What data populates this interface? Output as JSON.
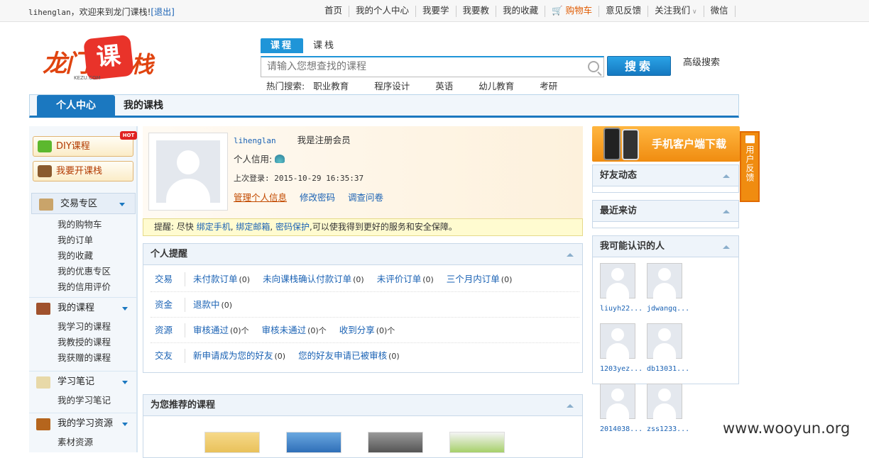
{
  "topbar": {
    "username": "lihenglan",
    "welcome": "，欢迎来到龙门课栈!",
    "logout": "[退出]",
    "nav": [
      "首页",
      "我的个人中心",
      "我要学",
      "我要教",
      "我的收藏",
      "购物车",
      "意见反馈",
      "关注我们",
      "微信"
    ]
  },
  "logo": {
    "part1": "龙门",
    "part2": "课",
    "part3": "栈",
    "domain": "KEZU.COM"
  },
  "search": {
    "tabs": [
      "课程",
      "课栈"
    ],
    "placeholder": "请输入您想查找的课程",
    "button": "搜索",
    "advanced": "高级搜索",
    "hot_label": "热门搜索:",
    "hot": [
      "职业教育",
      "程序设计",
      "英语",
      "幼儿教育",
      "考研"
    ]
  },
  "mainnav": {
    "tabs": [
      "个人中心",
      "我的课栈"
    ]
  },
  "sidebar": {
    "diy": "DIY课程",
    "hot_badge": "HOT",
    "teach": "我要开课栈",
    "groups": [
      {
        "title": "交易专区",
        "items": [
          "我的购物车",
          "我的订单",
          "我的收藏",
          "我的优惠专区",
          "我的信用评价"
        ]
      },
      {
        "title": "我的课程",
        "items": [
          "我学习的课程",
          "我教授的课程",
          "我获赠的课程"
        ]
      },
      {
        "title": "学习笔记",
        "items": [
          "我的学习笔记"
        ]
      },
      {
        "title": "我的学习资源",
        "items": [
          "素材资源"
        ]
      }
    ]
  },
  "profile": {
    "username": "lihenglan",
    "member": "我是注册会员",
    "credit_label": "个人信用:",
    "last_login": "上次登录: 2015-10-29 16:35:37",
    "links": [
      "管理个人信息",
      "修改密码",
      "调查问卷"
    ]
  },
  "tip": {
    "prefix": "提醒: 尽快",
    "l1": "绑定手机",
    "sep": ",",
    "l2": "绑定邮箱",
    "l3": "密码保护",
    "suffix": ",可以使我得到更好的服务和安全保障。"
  },
  "reminders": {
    "title": "个人提醒",
    "rows": [
      {
        "cat": "交易",
        "items": [
          {
            "label": "未付款订单",
            "count": "(0)"
          },
          {
            "label": "未向课栈确认付款订单",
            "count": "(0)"
          },
          {
            "label": "未评价订单",
            "count": "(0)"
          },
          {
            "label": "三个月内订单",
            "count": "(0)"
          }
        ]
      },
      {
        "cat": "资金",
        "items": [
          {
            "label": "退款中",
            "count": "(0)"
          }
        ]
      },
      {
        "cat": "资源",
        "items": [
          {
            "label": "审核通过",
            "count": "(0)个"
          },
          {
            "label": "审核未通过",
            "count": "(0)个"
          },
          {
            "label": "收到分享",
            "count": "(0)个"
          }
        ]
      },
      {
        "cat": "交友",
        "items": [
          {
            "label": "新申请成为您的好友",
            "count": "(0)"
          },
          {
            "label": "您的好友申请已被审核",
            "count": "(0)"
          }
        ]
      }
    ]
  },
  "recommend": {
    "title": "为您推荐的课程"
  },
  "right": {
    "banner": "手机客户端下载",
    "feedback": "用户反馈",
    "friend_activity": "好友动态",
    "recent": "最近来访",
    "people_title": "我可能认识的人",
    "people": [
      "liuyh22...",
      "jdwangq...",
      "1203yez...",
      "db13031...",
      "2014038...",
      "zss1233..."
    ]
  },
  "watermark": "www.wooyun.org"
}
